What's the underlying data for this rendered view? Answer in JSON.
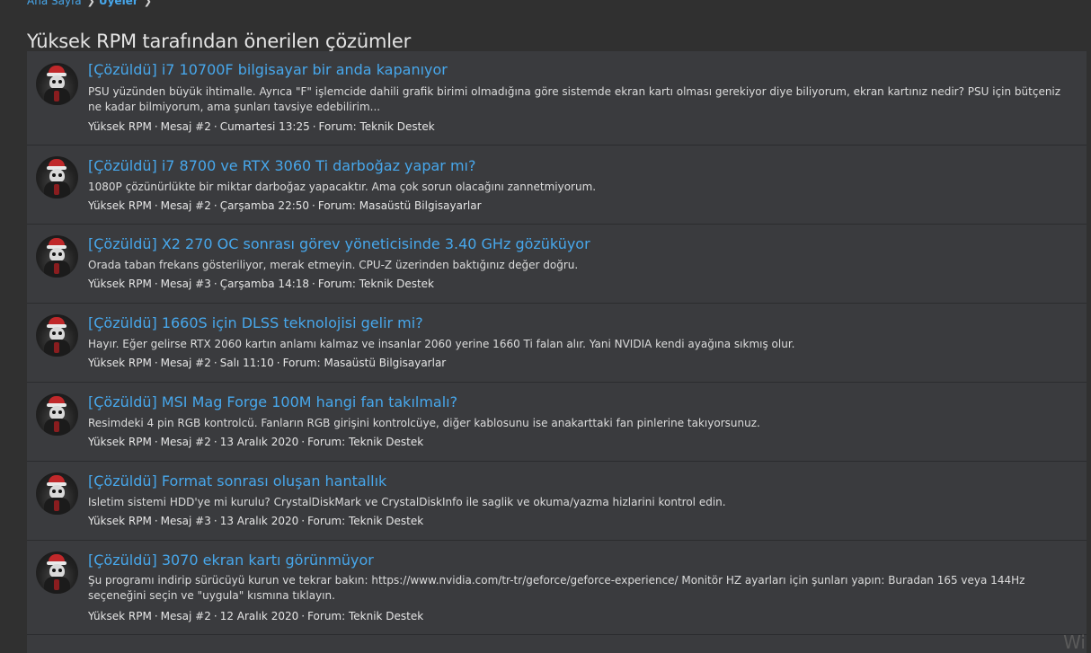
{
  "breadcrumb": {
    "home": "Ana Sayfa",
    "members": "Üyeler"
  },
  "page_title": "Yüksek RPM tarafından önerilen çözümler",
  "results": [
    {
      "title": "[Çözüldü] i7 10700F bilgisayar bir anda kapanıyor",
      "snippet": "PSU yüzünden büyük ihtimalle. Ayrıca \"F\" işlemcide dahili grafik birimi olmadığına göre sistemde ekran kartı olması gerekiyor diye biliyorum, ekran kartınız nedir? PSU için bütçeniz ne kadar bilmiyorum, ama şunları tavsiye edebilirim...",
      "author": "Yüksek RPM",
      "post": "Mesaj #2",
      "date": "Cumartesi 13:25",
      "forum": "Forum: Teknik Destek"
    },
    {
      "title": "[Çözüldü] i7 8700 ve RTX 3060 Ti darboğaz yapar mı?",
      "snippet": "1080P çözünürlükte bir miktar darboğaz yapacaktır. Ama çok sorun olacağını zannetmiyorum.",
      "author": "Yüksek RPM",
      "post": "Mesaj #2",
      "date": "Çarşamba 22:50",
      "forum": "Forum: Masaüstü Bilgisayarlar"
    },
    {
      "title": "[Çözüldü] X2 270 OC sonrası görev yöneticisinde 3.40 GHz gözüküyor",
      "snippet": "Orada taban frekans gösteriliyor, merak etmeyin. CPU-Z üzerinden baktığınız değer doğru.",
      "author": "Yüksek RPM",
      "post": "Mesaj #3",
      "date": "Çarşamba 14:18",
      "forum": "Forum: Teknik Destek"
    },
    {
      "title": "[Çözüldü] 1660S için DLSS teknolojisi gelir mi?",
      "snippet": "Hayır. Eğer gelirse RTX 2060 kartın anlamı kalmaz ve insanlar 2060 yerine 1660 Ti falan alır. Yani NVIDIA kendi ayağına sıkmış olur.",
      "author": "Yüksek RPM",
      "post": "Mesaj #2",
      "date": "Salı 11:10",
      "forum": "Forum: Masaüstü Bilgisayarlar"
    },
    {
      "title": "[Çözüldü] MSI Mag Forge 100M hangi fan takılmalı?",
      "snippet": "Resimdeki 4 pin RGB kontrolcü. Fanların RGB girişini kontrolcüye, diğer kablosunu ise anakarttaki fan pinlerine takıyorsunuz.",
      "author": "Yüksek RPM",
      "post": "Mesaj #2",
      "date": "13 Aralık 2020",
      "forum": "Forum: Teknik Destek"
    },
    {
      "title": "[Çözüldü] Format sonrası oluşan hantallık",
      "snippet": "Isletim sistemi HDD'ye mi kurulu? CrystalDiskMark ve CrystalDiskInfo ile saglik ve okuma/yazma hizlarini kontrol edin.",
      "author": "Yüksek RPM",
      "post": "Mesaj #3",
      "date": "13 Aralık 2020",
      "forum": "Forum: Teknik Destek"
    },
    {
      "title": "[Çözüldü] 3070 ekran kartı görünmüyor",
      "snippet": "Şu programı indirip sürücüyü kurun ve tekrar bakın: https://www.nvidia.com/tr-tr/geforce/geforce-experience/ Monitör HZ ayarları için şunları yapın: Buradan 165 veya 144Hz seçeneğini seçin ve \"uygula\" kısmına tıklayın.",
      "author": "Yüksek RPM",
      "post": "Mesaj #2",
      "date": "12 Aralık 2020",
      "forum": "Forum: Teknik Destek"
    }
  ],
  "separator": "·",
  "corner_text": "Wi"
}
